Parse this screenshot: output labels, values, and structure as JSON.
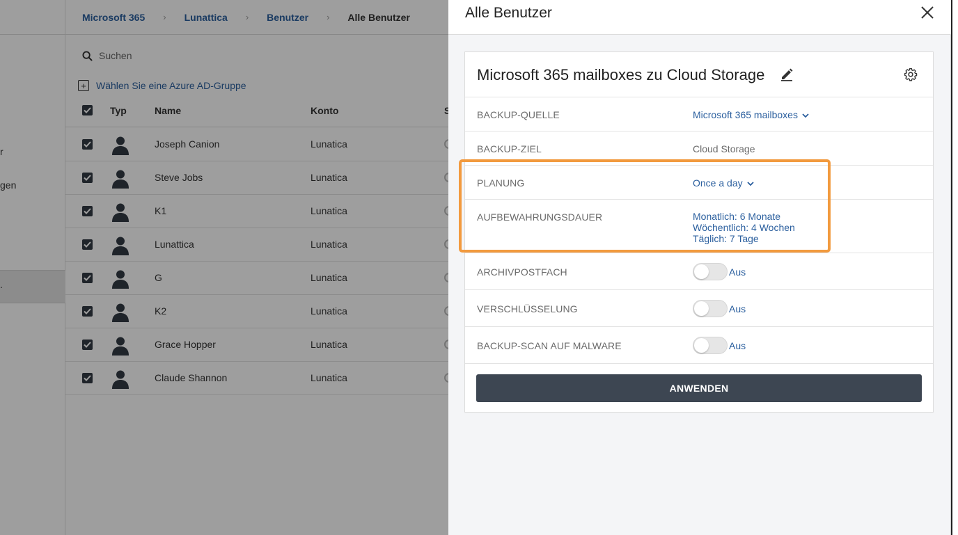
{
  "left_nav": {
    "items": [
      "r",
      "gen",
      "."
    ]
  },
  "breadcrumb": {
    "items": [
      "Microsoft 365",
      "Lunattica",
      "Benutzer",
      "Alle Benutzer"
    ]
  },
  "search": {
    "placeholder": "Suchen",
    "icon": "search-icon"
  },
  "azure_group": {
    "label": "Wählen Sie eine Azure AD-Gruppe",
    "icon": "plus-square-icon"
  },
  "table": {
    "columns": [
      "Typ",
      "Name",
      "Konto",
      "S"
    ],
    "rows": [
      {
        "name": "Joseph Canion",
        "account": "Lunatica",
        "checked": true
      },
      {
        "name": "Steve Jobs",
        "account": "Lunatica",
        "checked": true
      },
      {
        "name": "K1",
        "account": "Lunatica",
        "checked": true
      },
      {
        "name": "Lunattica",
        "account": "Lunatica",
        "checked": true
      },
      {
        "name": "G",
        "account": "Lunatica",
        "checked": true
      },
      {
        "name": "K2",
        "account": "Lunatica",
        "checked": true
      },
      {
        "name": "Grace Hopper",
        "account": "Lunatica",
        "checked": true
      },
      {
        "name": "Claude Shannon",
        "account": "Lunatica",
        "checked": true
      }
    ]
  },
  "panel": {
    "title": "Alle Benutzer",
    "close_icon": "close-icon",
    "card": {
      "title": "Microsoft 365 mailboxes zu Cloud Storage",
      "fields": {
        "source": {
          "label": "BACKUP-QUELLE",
          "value": "Microsoft 365 mailboxes"
        },
        "target": {
          "label": "BACKUP-ZIEL",
          "value": "Cloud Storage"
        },
        "schedule": {
          "label": "PLANUNG",
          "value": "Once a day"
        },
        "retention": {
          "label": "AUFBEWAHRUNGSDAUER",
          "lines": [
            "Monatlich: 6 Monate",
            "Wöchentlich: 4 Wochen",
            "Täglich: 7 Tage"
          ]
        },
        "archive": {
          "label": "ARCHIVPOSTFACH",
          "state": "Aus"
        },
        "encryption": {
          "label": "VERSCHLÜSSELUNG",
          "state": "Aus"
        },
        "malware": {
          "label": "BACKUP-SCAN AUF MALWARE",
          "state": "Aus"
        }
      },
      "apply_label": "ANWENDEN"
    }
  },
  "colors": {
    "link": "#2b5f9e",
    "highlight": "#f29a3e",
    "button": "#3d4652"
  }
}
